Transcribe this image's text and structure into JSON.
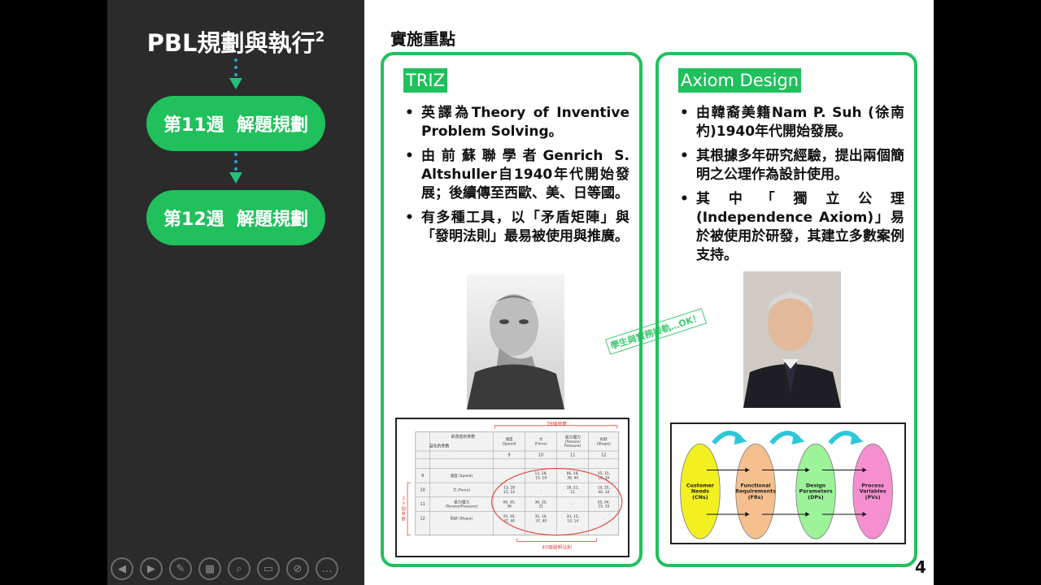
{
  "left_panel": {
    "title": "PBL規劃與執行",
    "title_sup": "2",
    "weeks": [
      "第11週  解題規劃",
      "第12週  解題規劃"
    ]
  },
  "controls": [
    {
      "icon": "prev-icon",
      "glyph": "◀"
    },
    {
      "icon": "next-icon",
      "glyph": "▶"
    },
    {
      "icon": "pen-icon",
      "glyph": "✎"
    },
    {
      "icon": "slides-icon",
      "glyph": "▦"
    },
    {
      "icon": "zoom-icon",
      "glyph": "⌕"
    },
    {
      "icon": "screen-icon",
      "glyph": "▭"
    },
    {
      "icon": "camera-icon",
      "glyph": "⊘"
    },
    {
      "icon": "more-icon",
      "glyph": "…"
    }
  ],
  "slide": {
    "heading": "實施重點",
    "page_number": "4",
    "stamp": "學生與實務接軌…OK！",
    "triz": {
      "tag": "TRIZ",
      "bullets": [
        "英譯為Theory of Inventive Problem Solving。",
        "由前蘇聯學者Genrich S. Altshuller自1940年代開始發展；後續傳至西歐、美、日等國。",
        "有多種工具，以「矛盾矩陣」與「發明法則」最易被使用與推廣。"
      ],
      "matrix": {
        "top_label": "39個參數",
        "side_label": "39個參數",
        "bottom_label": "40個發明法則",
        "corner_top": "欲改善的參數",
        "corner_bottom": "惡化的參數",
        "col_headers": [
          {
            "num": "9",
            "name": "速度\n(Speed)"
          },
          {
            "num": "10",
            "name": "力\n(Force)"
          },
          {
            "num": "11",
            "name": "張力/壓力\n(Tension/\nPressure)"
          },
          {
            "num": "12",
            "name": "形狀\n(Shape)"
          }
        ],
        "rows": [
          {
            "num": "9",
            "name": "速度 (Speed)",
            "cells": [
              "",
              "13, 28,\n15, 19",
              "06, 18,\n38, 40",
              "35, 15,\n18, 34"
            ]
          },
          {
            "num": "10",
            "name": "力 (Force)",
            "cells": [
              "13, 28\n15, 12",
              "-",
              "18, 21,\n11",
              "10, 35,\n40, 34"
            ]
          },
          {
            "num": "11",
            "name": "張力/壓力\n(Tension/Pressure)",
            "cells": [
              "06, 35,\n36",
              "36, 35,\n21",
              "-",
              "35, 04,\n15, 10"
            ]
          },
          {
            "num": "12",
            "name": "形狀 (Shape)",
            "cells": [
              "35, 10,\n37, 40",
              "35, 10,\n37, 40",
              "34, 15,\n10, 14",
              "-"
            ]
          }
        ]
      }
    },
    "axiom": {
      "tag": "Axiom Design",
      "bullets": [
        "由韓裔美籍Nam P. Suh (徐南杓)1940年代開始發展。",
        "其根據多年研究經驗，提出兩個簡明之公理作為設計使用。",
        "其中「獨立公理(Independence Axiom)」易於被使用於研發，其建立多數案例支持。"
      ],
      "domains": [
        {
          "label": "Customer\nNeeds\n(CNs)",
          "color": "#f3f020"
        },
        {
          "label": "Functional\nRequirements\n(FRs)",
          "color": "#f6c08e"
        },
        {
          "label": "Design\nParameters\n(DPs)",
          "color": "#9cf39a"
        },
        {
          "label": "Process\nVariables\n(PVs)",
          "color": "#f68fd0"
        }
      ]
    }
  }
}
